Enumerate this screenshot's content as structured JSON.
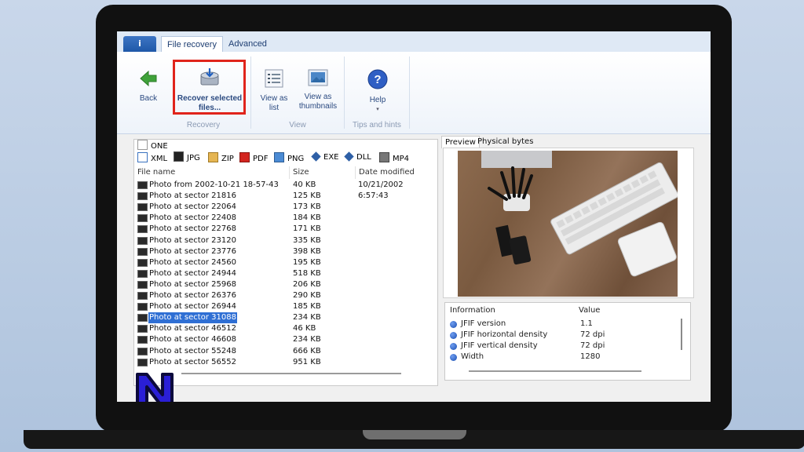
{
  "ribbon": {
    "tabs": [
      "File recovery",
      "Advanced"
    ],
    "app_button": "i",
    "buttons": {
      "back": "Back",
      "recover": "Recover selected files...",
      "view_list": "View as list",
      "view_thumbs": "View as thumbnails",
      "help": "Help"
    },
    "groups": [
      "Recovery",
      "View",
      "Tips and hints"
    ]
  },
  "file_types": [
    "ONE",
    "XML",
    "JPG",
    "ZIP",
    "PDF",
    "PNG",
    "EXE",
    "DLL",
    "MP4"
  ],
  "file_list": {
    "columns": [
      "File name",
      "Size",
      "Date modified"
    ],
    "rows": [
      {
        "name": "Photo from 2002-10-21 18-57-43",
        "size": "40 KB",
        "date": "10/21/2002 6:57:43"
      },
      {
        "name": "Photo at sector 21816",
        "size": "125 KB",
        "date": ""
      },
      {
        "name": "Photo at sector 22064",
        "size": "173 KB",
        "date": ""
      },
      {
        "name": "Photo at sector 22408",
        "size": "184 KB",
        "date": ""
      },
      {
        "name": "Photo at sector 22768",
        "size": "171 KB",
        "date": ""
      },
      {
        "name": "Photo at sector 23120",
        "size": "335 KB",
        "date": ""
      },
      {
        "name": "Photo at sector 23776",
        "size": "398 KB",
        "date": ""
      },
      {
        "name": "Photo at sector 24560",
        "size": "195 KB",
        "date": ""
      },
      {
        "name": "Photo at sector 24944",
        "size": "518 KB",
        "date": ""
      },
      {
        "name": "Photo at sector 25968",
        "size": "206 KB",
        "date": ""
      },
      {
        "name": "Photo at sector 26376",
        "size": "290 KB",
        "date": ""
      },
      {
        "name": "Photo at sector 26944",
        "size": "185 KB",
        "date": ""
      },
      {
        "name": "Photo at sector 31088",
        "size": "234 KB",
        "date": ""
      },
      {
        "name": "Photo at sector 46512",
        "size": "46 KB",
        "date": ""
      },
      {
        "name": "Photo at sector 46608",
        "size": "234 KB",
        "date": ""
      },
      {
        "name": "Photo at sector 55248",
        "size": "666 KB",
        "date": ""
      },
      {
        "name": "Photo at sector 56552",
        "size": "951 KB",
        "date": ""
      }
    ],
    "selected_index": 12
  },
  "preview": {
    "tabs": [
      "Preview",
      "Physical bytes"
    ],
    "info_columns": [
      "Information",
      "Value"
    ],
    "info_rows": [
      {
        "key": "JFIF version",
        "value": "1.1"
      },
      {
        "key": "JFIF horizontal density",
        "value": "72 dpi"
      },
      {
        "key": "JFIF vertical density",
        "value": "72 dpi"
      },
      {
        "key": "Width",
        "value": "1280"
      }
    ]
  },
  "colors": {
    "highlight": "#e0241b",
    "selection": "#2f6fd4",
    "watermark": "#2a1fd6"
  }
}
